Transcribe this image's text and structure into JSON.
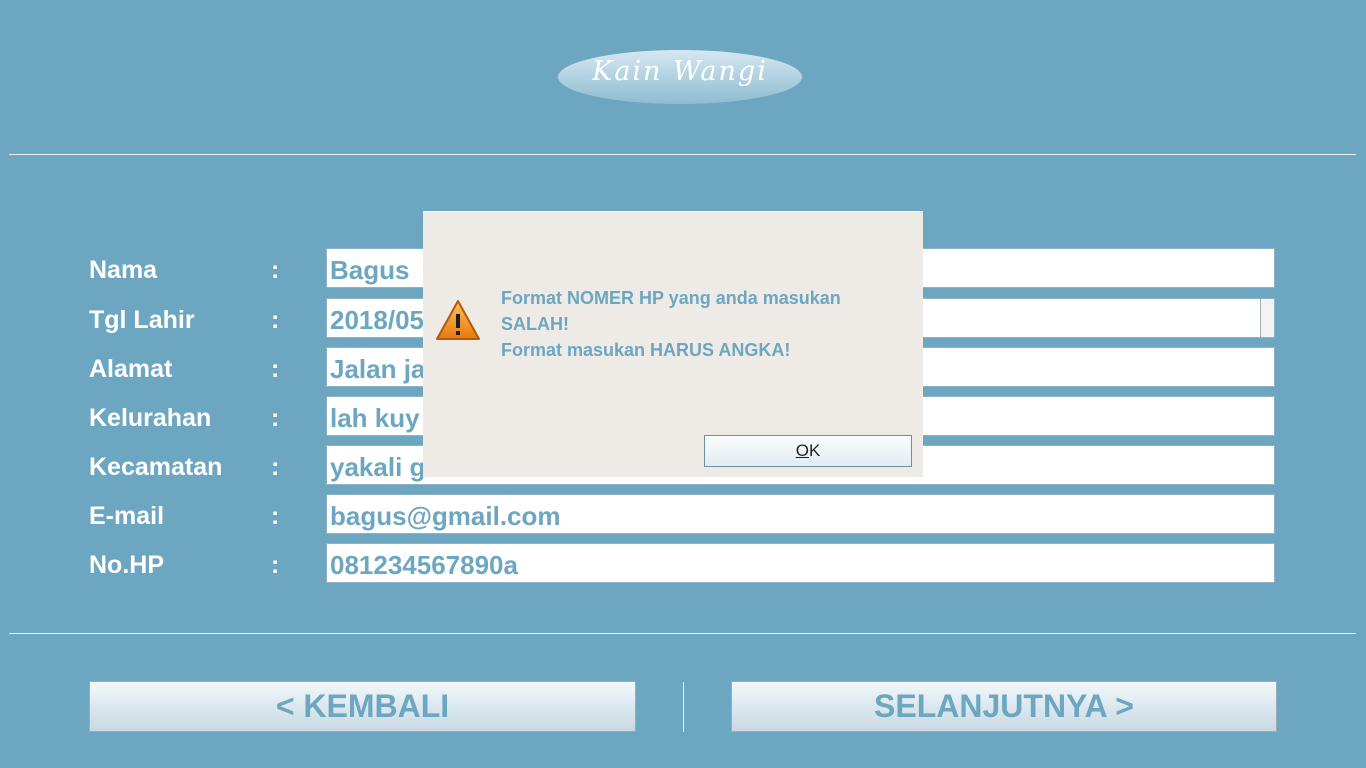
{
  "logo": {
    "text": "Kain Wangi"
  },
  "form": {
    "separator": ":",
    "rows": [
      {
        "label": "Nama",
        "value": "Bagus"
      },
      {
        "label": "Tgl Lahir",
        "value": "2018/05"
      },
      {
        "label": "Alamat",
        "value": "Jalan ja"
      },
      {
        "label": "Kelurahan",
        "value": "lah kuy"
      },
      {
        "label": "Kecamatan",
        "value": "yakali g"
      },
      {
        "label": "E-mail",
        "value": "bagus@gmail.com"
      },
      {
        "label": "No.HP",
        "value": "081234567890a"
      }
    ]
  },
  "buttons": {
    "back": "<  KEMBALI",
    "next": "SELANJUTNYA  >"
  },
  "dialog": {
    "line1": "Format NOMER HP yang anda masukan",
    "line2": "SALAH!",
    "line3": "Format masukan HARUS ANGKA!",
    "ok_mnemonic": "O",
    "ok_rest": "K",
    "icon": "warning-icon"
  },
  "colors": {
    "background": "#6ca6c1",
    "accent_text": "#6ca6c1",
    "dialog_bg": "#eeebe7"
  }
}
